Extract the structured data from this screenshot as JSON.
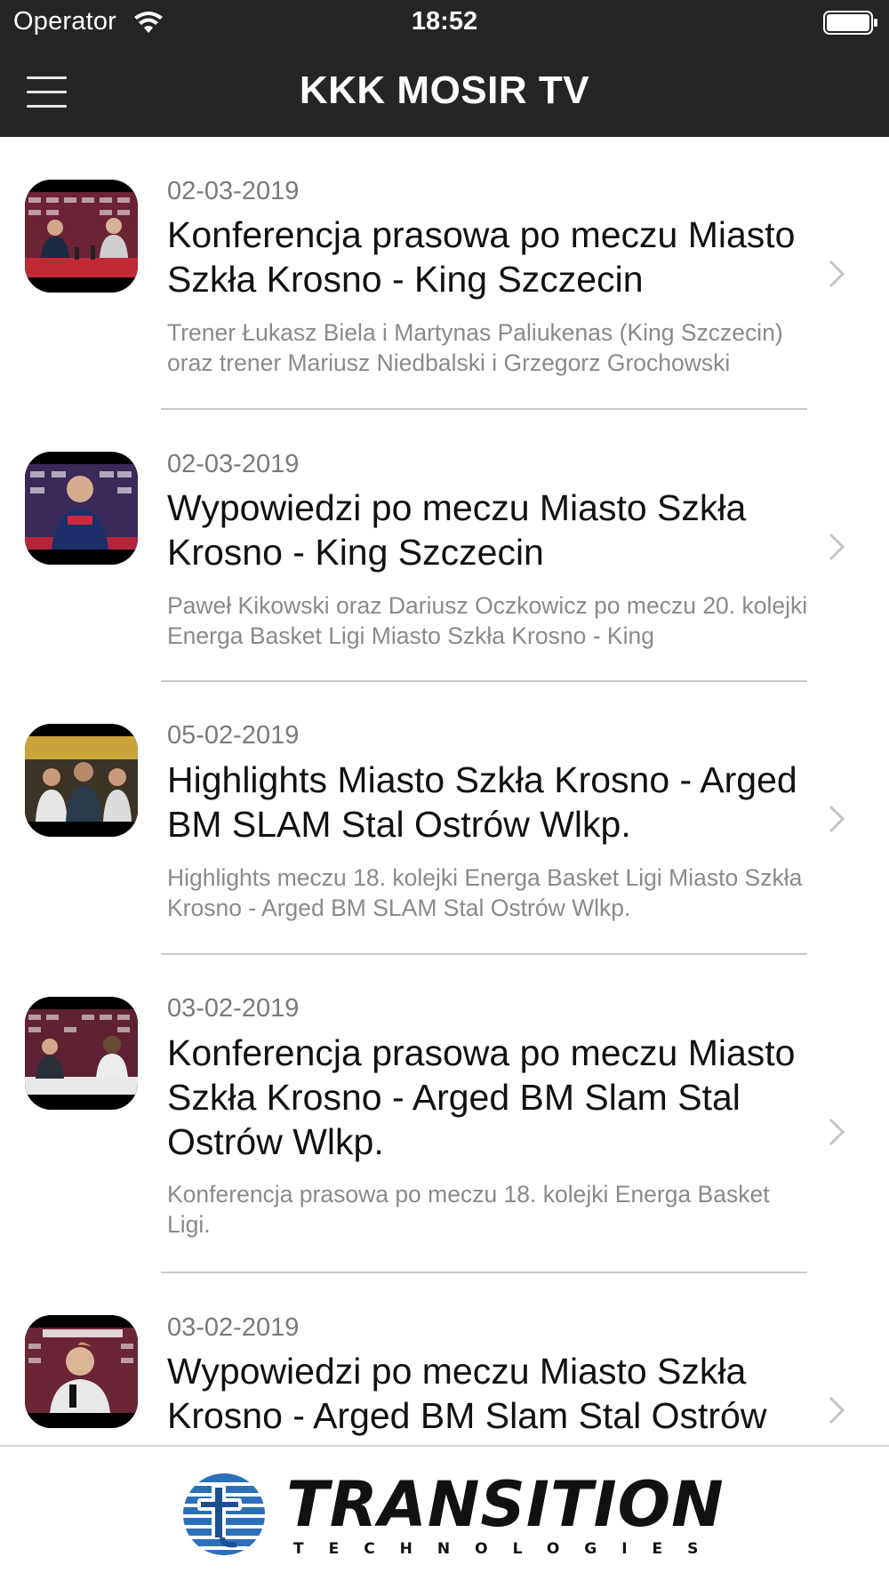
{
  "status_bar": {
    "operator": "Operator",
    "time": "18:52",
    "wifi_icon": "wifi-icon",
    "battery_icon": "battery-full-icon"
  },
  "nav": {
    "title": "KKK MOSIR TV",
    "menu_icon": "hamburger-menu-icon"
  },
  "videos": [
    {
      "date": "02-03-2019",
      "title": "Konferencja prasowa po meczu Miasto Szkła Krosno - King Szczecin",
      "description": "Trener Łukasz Biela i Martynas Paliukenas (King Szczecin) oraz trener Mariusz Niedbalski i Grzegorz Grochowski"
    },
    {
      "date": "02-03-2019",
      "title": "Wypowiedzi po meczu Miasto Szkła Krosno - King Szczecin",
      "description": "Paweł Kikowski oraz Dariusz Oczkowicz po meczu 20. kolejki Energa Basket Ligi Miasto Szkła Krosno - King"
    },
    {
      "date": "05-02-2019",
      "title": "Highlights Miasto Szkła Krosno - Arged BM SLAM Stal Ostrów Wlkp.",
      "description": "Highlights meczu 18. kolejki Energa Basket Ligi Miasto Szkła Krosno - Arged BM SLAM Stal Ostrów Wlkp."
    },
    {
      "date": "03-02-2019",
      "title": "Konferencja prasowa po meczu Miasto Szkła Krosno - Arged BM Slam Stal Ostrów Wlkp.",
      "description": "Konferencja prasowa po meczu 18. kolejki Energa Basket Ligi."
    },
    {
      "date": "03-02-2019",
      "title": "Wypowiedzi po meczu Miasto Szkła Krosno - Arged BM Slam Stal Ostrów",
      "description": ""
    }
  ],
  "footer": {
    "brand": "TRANSITION",
    "subtitle": "TECHNOLOGIES"
  },
  "colors": {
    "bar_background": "#252525",
    "title_text": "#111111",
    "meta_text": "#7a7a7a",
    "separator": "#c8c8c8"
  }
}
